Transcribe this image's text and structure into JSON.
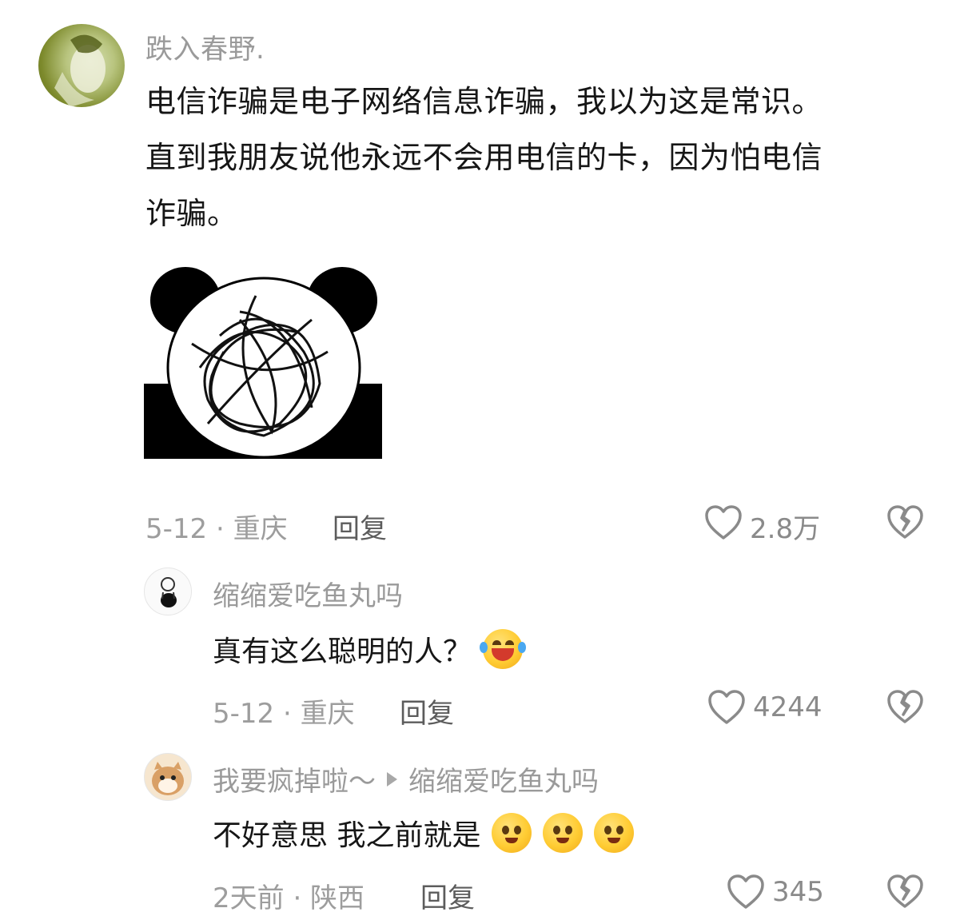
{
  "comment": {
    "author": "跌入春野.",
    "lines": [
      "电信诈骗是电子网络信息诈骗，我以为这是常识。",
      "直到我朋友说他永远不会用电信的卡，因为怕电信",
      "诈骗。"
    ],
    "meta": "5-12 · 重庆",
    "reply_label": "回复",
    "likes": "2.8万"
  },
  "replies": [
    {
      "author": "缩缩爱吃鱼丸吗",
      "text": "真有这么聪明的人？",
      "emojis": [
        "laugh-cry-emoji"
      ],
      "meta": "5-12 · 重庆",
      "reply_label": "回复",
      "likes": "4244"
    },
    {
      "author": "我要疯掉啦～",
      "reply_to": "缩缩爱吃鱼丸吗",
      "text": "不好意思 我之前就是",
      "emojis": [
        "pleading-emoji",
        "pleading-emoji",
        "pleading-emoji"
      ],
      "meta": "2天前 · 陕西",
      "reply_label": "回复",
      "likes": "345"
    }
  ],
  "icons": {
    "like": "heart-outline-icon",
    "dislike": "broken-heart-icon",
    "reply_arrow": "play-triangle-icon"
  },
  "colors": {
    "text": "#161616",
    "muted": "#9a9a9a",
    "reply": "#5c5c5c"
  }
}
